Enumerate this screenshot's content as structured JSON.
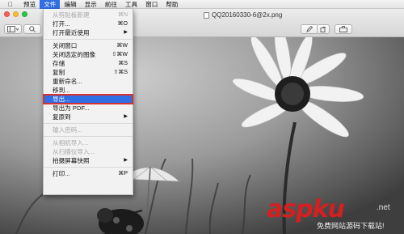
{
  "menubar": {
    "apple": "",
    "items": [
      "预览",
      "文件",
      "编辑",
      "显示",
      "前往",
      "工具",
      "窗口",
      "帮助"
    ],
    "active_index": 1
  },
  "window": {
    "title": "QQ20160330-6@2x.png"
  },
  "file_menu": {
    "items": [
      {
        "label": "从剪贴板新建",
        "shortcut": "⌘N",
        "enabled": false
      },
      {
        "label": "打开...",
        "shortcut": "⌘O",
        "enabled": true
      },
      {
        "label": "打开最近使用",
        "shortcut": "▶",
        "enabled": true
      },
      {
        "label": "关闭窗口",
        "shortcut": "⌘W",
        "enabled": true
      },
      {
        "label": "关闭选定的图像",
        "shortcut": "⇧⌘W",
        "enabled": true
      },
      {
        "label": "存储",
        "shortcut": "⌘S",
        "enabled": true
      },
      {
        "label": "复制",
        "shortcut": "⇧⌘S",
        "enabled": true
      },
      {
        "label": "重新命名...",
        "shortcut": "",
        "enabled": true
      },
      {
        "label": "移到...",
        "shortcut": "",
        "enabled": true
      },
      {
        "label": "导出...",
        "shortcut": "",
        "enabled": true,
        "highlighted": true
      },
      {
        "label": "导出为 PDF...",
        "shortcut": "",
        "enabled": true
      },
      {
        "label": "复原到",
        "shortcut": "▶",
        "enabled": true
      },
      {
        "label": "输入密码...",
        "shortcut": "",
        "enabled": false
      },
      {
        "label": "从相机导入...",
        "shortcut": "",
        "enabled": false
      },
      {
        "label": "从扫描仪导入...",
        "shortcut": "",
        "enabled": false
      },
      {
        "label": "拍摄屏幕快照",
        "shortcut": "▶",
        "enabled": true
      },
      {
        "label": "打印...",
        "shortcut": "⌘P",
        "enabled": true
      }
    ]
  },
  "watermark": {
    "logo": "aspku",
    "suffix": ".net",
    "subtitle": "免费网站源码下载站!"
  },
  "colors": {
    "menu_highlight": "#2f6ee5",
    "annotation_box": "#d63232",
    "watermark": "#d42020"
  }
}
